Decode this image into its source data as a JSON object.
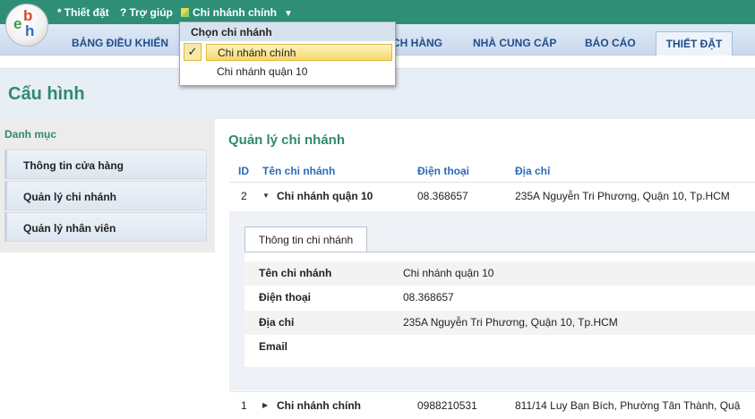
{
  "topbar": {
    "settings_icon": "*",
    "settings": "Thiết đặt",
    "help_icon": "?",
    "help": "Trợ giúp",
    "branch": "Chi nhánh chính",
    "branch_caret": "▼"
  },
  "logo": {
    "l1": "e",
    "l2": "b",
    "l3": "h"
  },
  "nav": {
    "dashboard": "BẢNG ĐIỀU KHIỂN",
    "customers_partial": "CH HÀNG",
    "suppliers": "NHÀ CUNG CẤP",
    "reports": "BÁO CÁO",
    "settings": "THIẾT ĐẶT"
  },
  "page": {
    "title": "Cấu hình"
  },
  "sidebar": {
    "heading": "Danh mục",
    "items": [
      {
        "label": "Thông tin cửa hàng"
      },
      {
        "label": "Quản lý chi nhánh"
      },
      {
        "label": "Quản lý nhân viên"
      }
    ]
  },
  "main": {
    "title": "Quản lý chi nhánh",
    "columns": {
      "id": "ID",
      "name": "Tên chi nhánh",
      "phone": "Điện thoại",
      "address": "Địa chỉ"
    },
    "rows": [
      {
        "id": "2",
        "arrow": "▼",
        "name": "Chi nhánh quận 10",
        "phone": "08.368657",
        "address": "235A Nguyễn Tri Phương, Quận 10, Tp.HCM"
      },
      {
        "id": "1",
        "arrow": "▶",
        "name": "Chi nhánh chính",
        "phone": "0988210531",
        "address": "811/14 Luy Bạn Bích, Phường Tân Thành, Quậ"
      }
    ],
    "detail": {
      "tab": "Thông tin chi nhánh",
      "fields": [
        {
          "label": "Tên chi nhánh",
          "value": "Chi nhánh quận 10"
        },
        {
          "label": "Điện thoại",
          "value": "08.368657"
        },
        {
          "label": "Địa chỉ",
          "value": "235A Nguyễn Tri Phương, Quận 10, Tp.HCM"
        },
        {
          "label": "Email",
          "value": ""
        }
      ]
    }
  },
  "dropdown": {
    "heading": "Chọn chi nhánh",
    "check": "✓",
    "options": [
      {
        "label": "Chi nhánh chính",
        "selected": true
      },
      {
        "label": "Chi nhánh quận 10",
        "selected": false
      }
    ]
  },
  "colors": {
    "topbar": "#2e8f76",
    "title_green": "#2f8a73",
    "nav_text": "#1f4e8c",
    "column_blue": "#2b6bb8"
  }
}
